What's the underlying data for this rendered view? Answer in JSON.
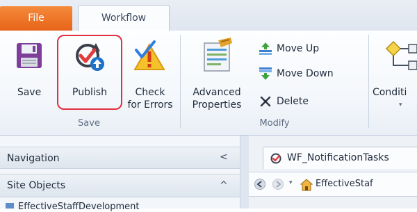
{
  "tabs": {
    "file": "File",
    "workflow": "Workflow"
  },
  "ribbon": {
    "save_group": {
      "label": "Save",
      "buttons": {
        "save": "Save",
        "publish": "Publish",
        "check": "Check\nfor Errors"
      }
    },
    "modify_group": {
      "label": "Modify",
      "advanced": "Advanced\nProperties",
      "move_up": "Move Up",
      "move_down": "Move Down",
      "delete": "Delete"
    },
    "conditions": {
      "label": "Conditi"
    }
  },
  "nav_pane": {
    "title": "Navigation",
    "site_objects": "Site Objects",
    "collapse_glyph": "<",
    "expand_glyph": "^",
    "partial_item": "EffectiveStaffDevelopment"
  },
  "document": {
    "tab_title": "WF_NotificationTasks",
    "breadcrumb": "EffectiveStaf"
  },
  "colors": {
    "file_tab": "#e96d24",
    "highlight": "#e03040",
    "ribbon_bg": "#f4f7fb"
  }
}
